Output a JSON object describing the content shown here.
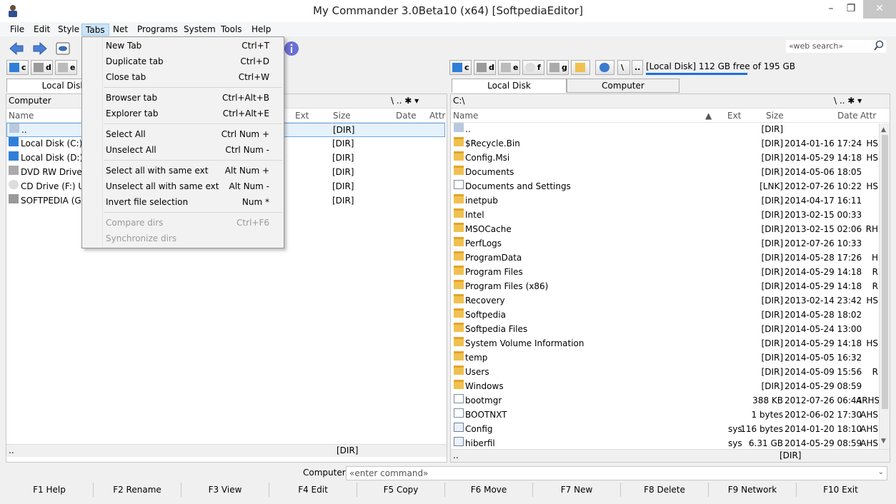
{
  "window": {
    "title": "My Commander 3.0Beta10 (x64) [SoftpediaEditor]"
  },
  "menu": [
    "File",
    "Edit",
    "Style",
    "Tabs",
    "Net",
    "Programs",
    "System",
    "Tools",
    "Help"
  ],
  "toolbar": {
    "web_search_placeholder": "«web search»"
  },
  "left": {
    "drives": [
      "c",
      "d",
      "e"
    ],
    "tab_label": "Local Disk",
    "path": "Computer",
    "columns": {
      "name": "Name",
      "ext": "Ext",
      "size": "Size",
      "date": "Date",
      "attr": "Attr"
    },
    "rows": [
      {
        "name": "..",
        "size": "[DIR]"
      },
      {
        "name": "Local Disk (C:)",
        "size": "[DIR]"
      },
      {
        "name": "Local Disk (D:)",
        "size": "[DIR]"
      },
      {
        "name": "DVD RW Drive (E",
        "size": "[DIR]"
      },
      {
        "name": "CD Drive (F:) U3",
        "size": "[DIR]"
      },
      {
        "name": "SOFTPEDIA (G:)",
        "size": "[DIR]"
      }
    ],
    "status_name": "..",
    "status_value": "[DIR]"
  },
  "right": {
    "drives": [
      "c",
      "d",
      "e",
      "f",
      "g"
    ],
    "free_space": "[Local Disk] 112 GB free of 195 GB",
    "tabs": [
      "Local Disk",
      "Computer"
    ],
    "path": "C:\\",
    "columns": {
      "name": "Name",
      "ext": "Ext",
      "size": "Size",
      "date": "Date",
      "attr": "Attr"
    },
    "rows": [
      {
        "name": "..",
        "ext": "",
        "size": "[DIR]",
        "date": "",
        "attr": "",
        "icon": "up"
      },
      {
        "name": "$Recycle.Bin",
        "ext": "",
        "size": "[DIR]",
        "date": "2014-01-16 17:24",
        "attr": "HS",
        "icon": "folder"
      },
      {
        "name": "Config.Msi",
        "ext": "",
        "size": "[DIR]",
        "date": "2014-05-29 14:18",
        "attr": "HS",
        "icon": "folder"
      },
      {
        "name": "Documents",
        "ext": "",
        "size": "[DIR]",
        "date": "2014-05-06 18:05",
        "attr": "",
        "icon": "folder"
      },
      {
        "name": "Documents and Settings",
        "ext": "",
        "size": "[LNK]",
        "date": "2012-07-26 10:22",
        "attr": "HS",
        "icon": "link"
      },
      {
        "name": "inetpub",
        "ext": "",
        "size": "[DIR]",
        "date": "2014-04-17 16:11",
        "attr": "",
        "icon": "folder"
      },
      {
        "name": "Intel",
        "ext": "",
        "size": "[DIR]",
        "date": "2013-02-15 00:33",
        "attr": "",
        "icon": "folder"
      },
      {
        "name": "MSOCache",
        "ext": "",
        "size": "[DIR]",
        "date": "2013-02-15 02:06",
        "attr": "RH",
        "icon": "folder"
      },
      {
        "name": "PerfLogs",
        "ext": "",
        "size": "[DIR]",
        "date": "2012-07-26 10:33",
        "attr": "",
        "icon": "folder"
      },
      {
        "name": "ProgramData",
        "ext": "",
        "size": "[DIR]",
        "date": "2014-05-28 17:26",
        "attr": "H",
        "icon": "folder"
      },
      {
        "name": "Program Files",
        "ext": "",
        "size": "[DIR]",
        "date": "2014-05-29 14:18",
        "attr": "R",
        "icon": "folder"
      },
      {
        "name": "Program Files (x86)",
        "ext": "",
        "size": "[DIR]",
        "date": "2014-05-29 14:18",
        "attr": "R",
        "icon": "folder"
      },
      {
        "name": "Recovery",
        "ext": "",
        "size": "[DIR]",
        "date": "2013-02-14 23:42",
        "attr": "HS",
        "icon": "folder"
      },
      {
        "name": "Softpedia",
        "ext": "",
        "size": "[DIR]",
        "date": "2014-05-28 18:02",
        "attr": "",
        "icon": "folder"
      },
      {
        "name": "Softpedia Files",
        "ext": "",
        "size": "[DIR]",
        "date": "2014-05-24 13:00",
        "attr": "",
        "icon": "folder"
      },
      {
        "name": "System Volume Information",
        "ext": "",
        "size": "[DIR]",
        "date": "2014-05-29 14:18",
        "attr": "HS",
        "icon": "folder"
      },
      {
        "name": "temp",
        "ext": "",
        "size": "[DIR]",
        "date": "2014-05-05 16:32",
        "attr": "",
        "icon": "folder"
      },
      {
        "name": "Users",
        "ext": "",
        "size": "[DIR]",
        "date": "2014-05-09 15:56",
        "attr": "R",
        "icon": "folder"
      },
      {
        "name": "Windows",
        "ext": "",
        "size": "[DIR]",
        "date": "2014-05-29 08:59",
        "attr": "",
        "icon": "folder"
      },
      {
        "name": "bootmgr",
        "ext": "",
        "size": "388 KB",
        "date": "2012-07-26 06:44",
        "attr": "ARHS",
        "icon": "file"
      },
      {
        "name": "BOOTNXT",
        "ext": "",
        "size": "1 bytes",
        "date": "2012-06-02 17:30",
        "attr": "AHS",
        "icon": "file"
      },
      {
        "name": "Config",
        "ext": "sys",
        "size": "116 bytes",
        "date": "2014-01-20 18:10",
        "attr": "AHS",
        "icon": "sys"
      },
      {
        "name": "hiberfil",
        "ext": "sys",
        "size": "6.31 GB",
        "date": "2014-05-29 08:59",
        "attr": "AHS",
        "icon": "sys"
      }
    ],
    "status_name": "..",
    "status_value": "[DIR]"
  },
  "command": {
    "label": "Computer",
    "placeholder": "«enter command»"
  },
  "fkeys": [
    "F1 Help",
    "F2 Rename",
    "F3 View",
    "F4 Edit",
    "F5 Copy",
    "F6 Move",
    "F7 New",
    "F8 Delete",
    "F9 Network",
    "F10 Exit"
  ],
  "tabs_menu": [
    {
      "label": "New Tab",
      "shortcut": "Ctrl+T",
      "enabled": true
    },
    {
      "label": "Duplicate tab",
      "shortcut": "Ctrl+D",
      "enabled": true
    },
    {
      "label": "Close tab",
      "shortcut": "Ctrl+W",
      "enabled": true
    },
    {
      "sep": true
    },
    {
      "label": "Browser tab",
      "shortcut": "Ctrl+Alt+B",
      "enabled": true
    },
    {
      "label": "Explorer tab",
      "shortcut": "Ctrl+Alt+E",
      "enabled": true
    },
    {
      "sep": true
    },
    {
      "label": "Select All",
      "shortcut": "Ctrl Num +",
      "enabled": true
    },
    {
      "label": "Unselect All",
      "shortcut": "Ctrl Num -",
      "enabled": true
    },
    {
      "sep": true
    },
    {
      "label": "Select all with same ext",
      "shortcut": "Alt Num +",
      "enabled": true
    },
    {
      "label": "Unselect all with same ext",
      "shortcut": "Alt Num -",
      "enabled": true
    },
    {
      "label": "Invert file selection",
      "shortcut": "Num *",
      "enabled": true
    },
    {
      "sep": true
    },
    {
      "label": "Compare dirs",
      "shortcut": "Ctrl+F6",
      "enabled": false
    },
    {
      "label": "Synchronize dirs",
      "shortcut": "",
      "enabled": false
    }
  ]
}
